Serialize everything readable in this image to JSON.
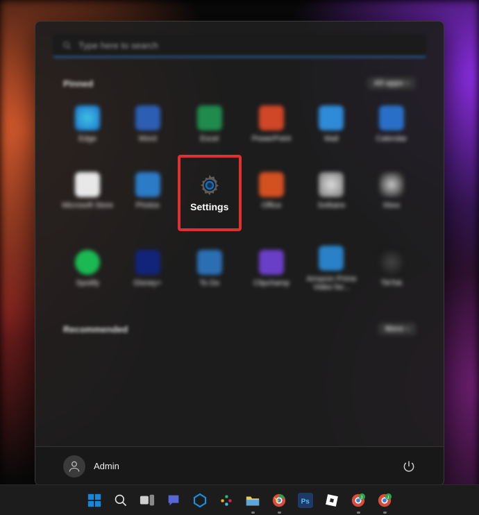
{
  "search": {
    "placeholder": "Type here to search"
  },
  "sections": {
    "pinned": {
      "title": "Pinned",
      "allapps": "All apps"
    },
    "recommended": {
      "title": "Recommended",
      "more": "More"
    }
  },
  "apps": {
    "row1": [
      {
        "name": "Edge",
        "color": "#1a74d4"
      },
      {
        "name": "Word",
        "color": "#2c5fb3"
      },
      {
        "name": "Excel",
        "color": "#1f8b4c"
      },
      {
        "name": "PowerPoint",
        "color": "#d04727"
      },
      {
        "name": "Mail",
        "color": "#2f8ad8"
      },
      {
        "name": "Calendar",
        "color": "#2a6fc7"
      }
    ],
    "row2": [
      {
        "name": "Microsoft Store",
        "color": "#e8e8e8"
      },
      {
        "name": "Photos",
        "color": "#2c7bc7"
      },
      {
        "name": "Settings",
        "color": "#4a4a4a",
        "highlight": true
      },
      {
        "name": "Office",
        "color": "#d35021"
      },
      {
        "name": "Solitaire",
        "color": "#2d2d2d"
      },
      {
        "name": "Xbox",
        "color": "#111"
      }
    ],
    "row3": [
      {
        "name": "Spotify",
        "color": "#1bb954"
      },
      {
        "name": "Disney+",
        "color": "#12247a"
      },
      {
        "name": "To Do",
        "color": "#2b6fb3"
      },
      {
        "name": "Clipchamp",
        "color": "#6a3fc7"
      },
      {
        "name": "Amazon Prime Video for...",
        "color": "#2a81c7"
      },
      {
        "name": "TikTok",
        "color": "#111"
      }
    ]
  },
  "user": {
    "name": "Admin"
  },
  "taskbar": [
    {
      "id": "start",
      "color": "#1985d6"
    },
    {
      "id": "search",
      "color": "#e0e0e0"
    },
    {
      "id": "taskview",
      "color": "#cfcfcf"
    },
    {
      "id": "chat",
      "color": "#4c5fd6"
    },
    {
      "id": "onedrive",
      "color": "#1c8fe0"
    },
    {
      "id": "slack",
      "color": "#e6e6e6"
    },
    {
      "id": "explorer",
      "color": "#f2c94c"
    },
    {
      "id": "chrome",
      "color": "#d94b3b"
    },
    {
      "id": "photoshop",
      "color": "#1d3a66"
    },
    {
      "id": "roblox",
      "color": "#ffffff"
    },
    {
      "id": "chrome-profile-1",
      "color": "#d94b3b"
    },
    {
      "id": "chrome-profile-2",
      "color": "#d94b3b"
    }
  ]
}
